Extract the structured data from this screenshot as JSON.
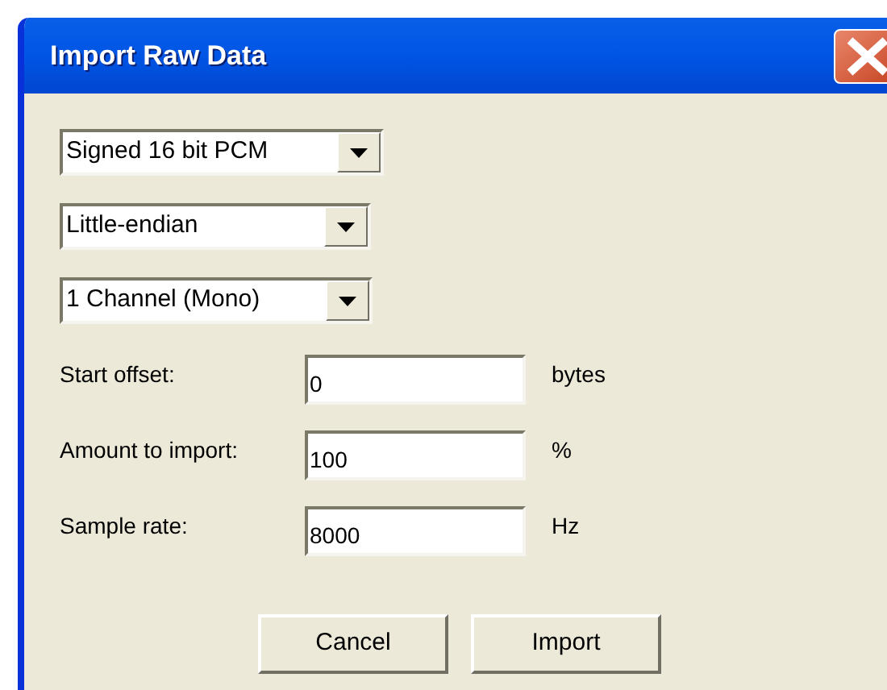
{
  "window": {
    "title": "Import Raw Data"
  },
  "dropdowns": [
    {
      "value": "Signed 16 bit PCM"
    },
    {
      "value": "Little-endian"
    },
    {
      "value": "1 Channel (Mono)"
    }
  ],
  "fields": [
    {
      "label": "Start offset:",
      "value": "0",
      "unit": "bytes"
    },
    {
      "label": "Amount to import:",
      "value": "100",
      "unit": "%"
    },
    {
      "label": "Sample rate:",
      "value": "8000",
      "unit": "Hz"
    }
  ],
  "buttons": [
    "Cancel",
    "Import"
  ]
}
